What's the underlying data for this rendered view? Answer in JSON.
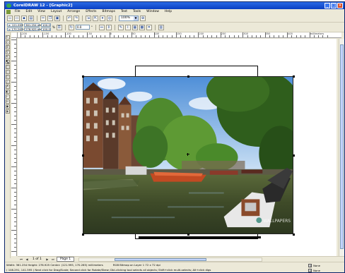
{
  "window": {
    "title": "CorelDRAW 12 - [Graphic2]",
    "controls": [
      "_",
      "□",
      "×"
    ]
  },
  "menu": {
    "items": [
      "File",
      "Edit",
      "View",
      "Layout",
      "Arrange",
      "Effects",
      "Bitmaps",
      "Text",
      "Tools",
      "Window",
      "Help"
    ]
  },
  "toolbar": {
    "zoom_value": "100%"
  },
  "property_bar": {
    "x": "x: 121.995 mm",
    "y": "y: 170.265 mm",
    "width": "361.254 mm",
    "height": "278.925 mm",
    "scale_x": "100.0",
    "scale_y": "100.0",
    "scale_unit": "%",
    "rotation": "0.0",
    "rotation_unit": "°"
  },
  "ruler": {
    "labels": [
      "-200",
      "-150",
      "-100",
      "-50",
      "0",
      "50",
      "100",
      "150",
      "200",
      "250",
      "300",
      "350",
      "400",
      "millimeters"
    ]
  },
  "pages": {
    "count_label": "1 of 1",
    "current_tab": "Page 1"
  },
  "status": {
    "line1_left": "Width: 361.254  Height: 278.925  Center: (121.995, 170.265)  millimeters",
    "line1_mid": "RGB Bitmap on Layer 1 72 x 72 dpi",
    "line2": "( 108.291, 141.595 )   Next click for Drag/Scale; Second click for Rotate/Skew; Dbl-clicking tool selects all objects; Shift+click multi-selects; Alt+click digs",
    "fill": "None",
    "outline": "None"
  },
  "photo": {
    "watermark": "WALLPAPERS"
  }
}
